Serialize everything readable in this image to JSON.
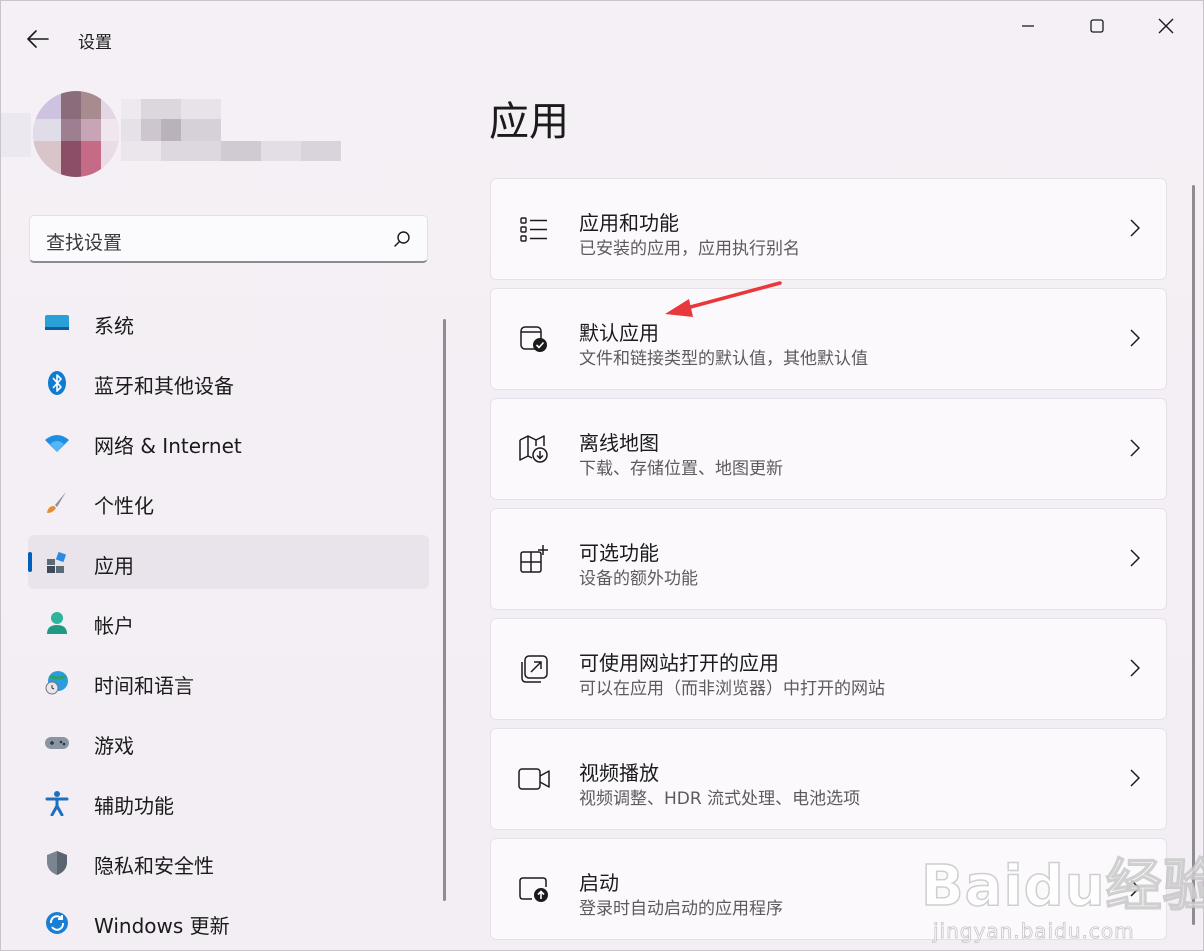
{
  "window": {
    "title": "设置",
    "back_icon": "back-arrow-icon",
    "controls": [
      "minimize-icon",
      "maximize-icon",
      "close-icon"
    ]
  },
  "search": {
    "placeholder": "查找设置",
    "icon": "search-icon"
  },
  "sidebar": {
    "items": [
      {
        "label": "系统",
        "icon": "system-display-icon",
        "selected": false
      },
      {
        "label": "蓝牙和其他设备",
        "icon": "bluetooth-icon",
        "selected": false
      },
      {
        "label": "网络 & Internet",
        "icon": "wifi-icon",
        "selected": false
      },
      {
        "label": "个性化",
        "icon": "paintbrush-icon",
        "selected": false
      },
      {
        "label": "应用",
        "icon": "apps-icon",
        "selected": true
      },
      {
        "label": "帐户",
        "icon": "account-icon",
        "selected": false
      },
      {
        "label": "时间和语言",
        "icon": "globe-clock-icon",
        "selected": false
      },
      {
        "label": "游戏",
        "icon": "gamepad-icon",
        "selected": false
      },
      {
        "label": "辅助功能",
        "icon": "accessibility-icon",
        "selected": false
      },
      {
        "label": "隐私和安全性",
        "icon": "shield-icon",
        "selected": false
      },
      {
        "label": "Windows 更新",
        "icon": "windows-update-icon",
        "selected": false
      }
    ]
  },
  "main": {
    "title": "应用",
    "cards": [
      {
        "title": "应用和功能",
        "subtitle": "已安装的应用，应用执行别名",
        "icon": "list-icon"
      },
      {
        "title": "默认应用",
        "subtitle": "文件和链接类型的默认值，其他默认值",
        "icon": "default-app-check-icon"
      },
      {
        "title": "离线地图",
        "subtitle": "下载、存储位置、地图更新",
        "icon": "map-download-icon"
      },
      {
        "title": "可选功能",
        "subtitle": "设备的额外功能",
        "icon": "grid-plus-icon"
      },
      {
        "title": "可使用网站打开的应用",
        "subtitle": "可以在应用（而非浏览器）中打开的网站",
        "icon": "open-external-icon"
      },
      {
        "title": "视频播放",
        "subtitle": "视频调整、HDR 流式处理、电池选项",
        "icon": "video-camera-icon"
      },
      {
        "title": "启动",
        "subtitle": "登录时自动启动的应用程序",
        "icon": "startup-icon"
      }
    ]
  },
  "colors": {
    "accent": "#005fb8",
    "annotation_arrow": "#e8383b"
  },
  "watermark": {
    "main": "Baidu经验",
    "sub": "jingyan.baidu.com"
  }
}
